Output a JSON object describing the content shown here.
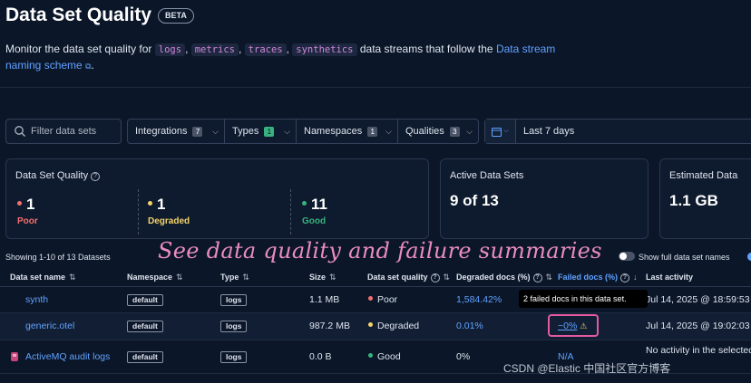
{
  "header": {
    "title": "Data Set Quality",
    "badge": "BETA",
    "desc_prefix": "Monitor the data set quality for",
    "streams": [
      "logs",
      "metrics",
      "traces",
      "synthetics"
    ],
    "desc_mid": "data streams that follow the",
    "desc_link": "Data stream naming scheme"
  },
  "filters": {
    "search_placeholder": "Filter data sets",
    "integrations": {
      "label": "Integrations",
      "count": "7"
    },
    "types": {
      "label": "Types",
      "count": "1"
    },
    "namespaces": {
      "label": "Namespaces",
      "count": "1"
    },
    "qualities": {
      "label": "Qualities",
      "count": "3"
    },
    "date_range": "Last 7 days"
  },
  "summary": {
    "quality": {
      "title": "Data Set Quality",
      "poor": {
        "value": "1",
        "label": "Poor"
      },
      "degraded": {
        "value": "1",
        "label": "Degraded"
      },
      "good": {
        "value": "11",
        "label": "Good"
      }
    },
    "active": {
      "title": "Active Data Sets",
      "value": "9 of 13"
    },
    "estimated": {
      "title": "Estimated Data",
      "value": "1.1 GB"
    }
  },
  "table": {
    "showing": "Showing 1-10 of 13 Datasets",
    "toggle_label": "Show full data set names",
    "columns": [
      "Data set name",
      "Namespace",
      "Type",
      "Size",
      "Data set quality",
      "Degraded docs (%)",
      "Failed docs (%)",
      "Last activity"
    ],
    "rows": [
      {
        "name": "synth",
        "namespace": "default",
        "type": "logs",
        "size": "1.1 MB",
        "quality": "Poor",
        "degraded": "1,584.42%",
        "failed": "",
        "last": "Jul 14, 2025 @ 18:59:53"
      },
      {
        "name": "generic.otel",
        "namespace": "default",
        "type": "logs",
        "size": "987.2 MB",
        "quality": "Degraded",
        "degraded": "0.01%",
        "failed": "~0%",
        "last": "Jul 14, 2025 @ 19:02:03"
      },
      {
        "name": "ActiveMQ audit logs",
        "namespace": "default",
        "type": "logs",
        "size": "0.0 B",
        "quality": "Good",
        "degraded": "0%",
        "failed": "N/A",
        "last": "No activity in the selected"
      }
    ]
  },
  "tooltip": "2 failed docs in this data set.",
  "annotation": "See data quality and failure summaries",
  "watermark": "CSDN @Elastic 中国社区官方博客",
  "colors": {
    "poor": "#f66f6f",
    "degraded": "#f5d46a",
    "good": "#36b37e",
    "link": "#61a2ff",
    "annotation": "#e98cc1"
  }
}
